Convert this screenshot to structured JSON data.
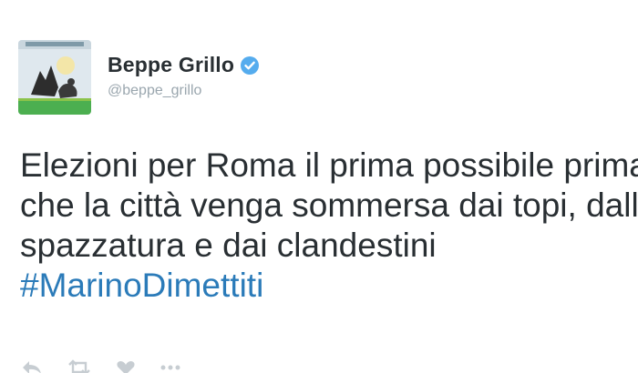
{
  "user": {
    "display_name": "Beppe Grillo",
    "handle": "@beppe_grillo",
    "verified": true
  },
  "tweet": {
    "lines": [
      "Elezioni per Roma il prima possibile prima",
      "che la città venga sommersa dai topi, dalla",
      "spazzatura e dai clandestini"
    ],
    "hashtag": "#MarinoDimettiti"
  },
  "colors": {
    "text": "#292f33",
    "hashtag": "#2b7bb9",
    "handle": "#9aa6ae",
    "verified_badge": "#55acee"
  },
  "actions": [
    {
      "icon": "reply-icon"
    },
    {
      "icon": "retweet-icon"
    },
    {
      "icon": "like-icon"
    },
    {
      "icon": "more-icon"
    }
  ]
}
